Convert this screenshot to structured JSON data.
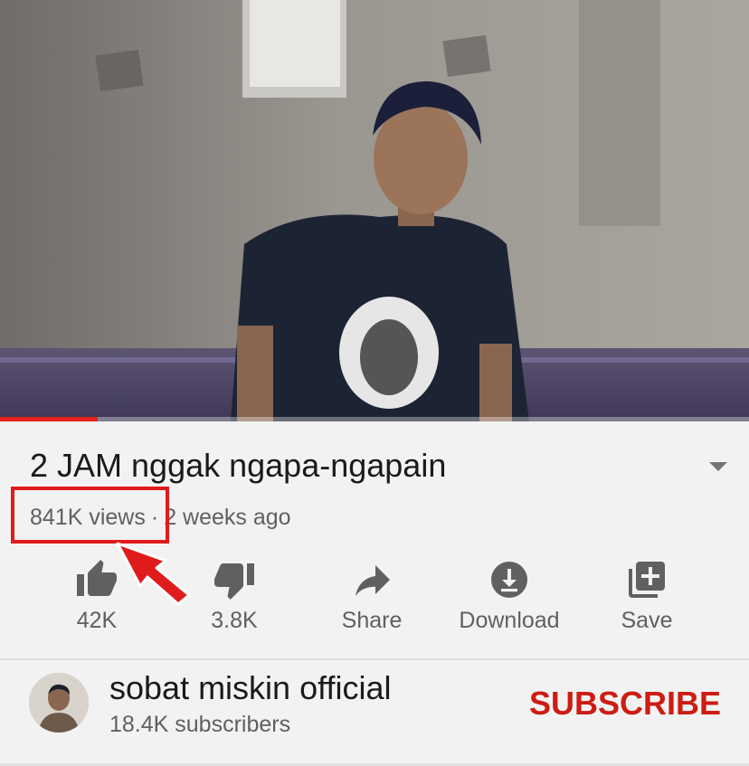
{
  "video": {
    "progress_fraction": 0.13
  },
  "title": "2 JAM nggak ngapa-ngapain",
  "meta": {
    "views": "841K views",
    "separator": "·",
    "age": "2 weeks ago"
  },
  "actions": {
    "like": {
      "icon": "thumbs-up-icon",
      "label": "42K"
    },
    "dislike": {
      "icon": "thumbs-down-icon",
      "label": "3.8K"
    },
    "share": {
      "icon": "share-icon",
      "label": "Share"
    },
    "download": {
      "icon": "download-icon",
      "label": "Download"
    },
    "save": {
      "icon": "playlist-add-icon",
      "label": "Save"
    }
  },
  "channel": {
    "name": "sobat miskin official",
    "subscribers": "18.4K subscribers",
    "subscribe_label": "SUBSCRIBE"
  },
  "colors": {
    "accent_red": "#cc1d14",
    "annotation_red": "#e01b1b",
    "progress_red": "#e62117",
    "icon_gray": "#606060"
  }
}
